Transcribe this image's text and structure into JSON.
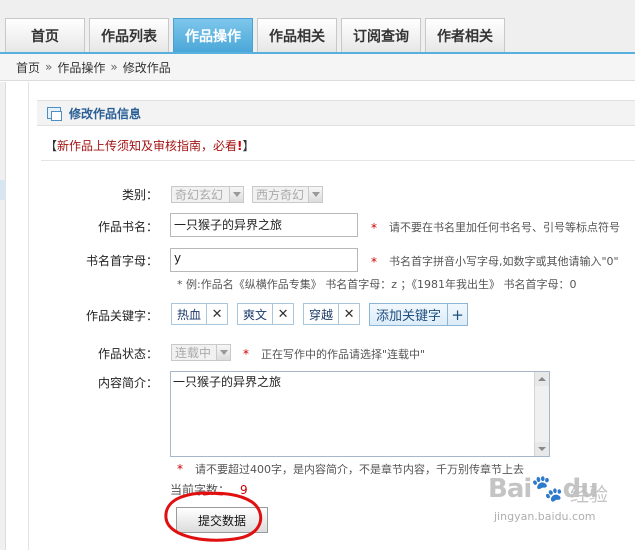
{
  "tabs": [
    {
      "label": "首页",
      "active": false
    },
    {
      "label": "作品列表",
      "active": false
    },
    {
      "label": "作品操作",
      "active": true
    },
    {
      "label": "作品相关",
      "active": false
    },
    {
      "label": "订阅查询",
      "active": false
    },
    {
      "label": "作者相关",
      "active": false
    }
  ],
  "breadcrumb": {
    "home": "首页",
    "sep": "»",
    "level1": "作品操作",
    "current": "修改作品"
  },
  "panel": {
    "title": "修改作品信息",
    "notice_open": "【",
    "notice_text": "新作品上传须知及审核指南，必看",
    "notice_bang": "!",
    "notice_close": "】"
  },
  "form": {
    "category": {
      "label": "类别：",
      "primary": "奇幻玄幻",
      "secondary": "西方奇幻"
    },
    "book_name": {
      "label": "作品书名：",
      "value": "一只猴子的异界之旅",
      "hint": "请不要在书名里加任何书名号、引号等标点符号"
    },
    "initial": {
      "label": "书名首字母：",
      "value": "y",
      "hint": "书名首字拼音小写字母,如数字或其他请输入\"0\"",
      "example": "* 例:作品名《纵横作品专集》 书名首字母：z ；《1981年我出生》 书名首字母：0"
    },
    "keywords": {
      "label": "作品关键字：",
      "items": [
        "热血",
        "爽文",
        "穿越"
      ],
      "remove_glyph": "✕",
      "add_label": "添加关键字",
      "add_glyph": "+"
    },
    "status": {
      "label": "作品状态：",
      "value": "连载中",
      "hint": "正在写作中的作品请选择\"连载中\""
    },
    "intro": {
      "label": "内容简介：",
      "value": "一只猴子的异界之旅",
      "hint": "请不要超过400字，是内容简介，不是章节内容，千万别传章节上去"
    },
    "char_count": {
      "label": "当前字数：",
      "value": "9"
    },
    "submit_label": "提交数据",
    "star": "*"
  },
  "colors": {
    "tab_active": "#4aa6d8",
    "bar_line": "#59b0dd",
    "title_blue": "#2a5f95",
    "notice_red": "#a31515",
    "required_red": "#cc0000",
    "circle_red": "#e01010"
  },
  "watermark": {
    "logo": "Bai",
    "paw": "du",
    "cn": "经验",
    "url": "jingyan.baidu.com"
  }
}
